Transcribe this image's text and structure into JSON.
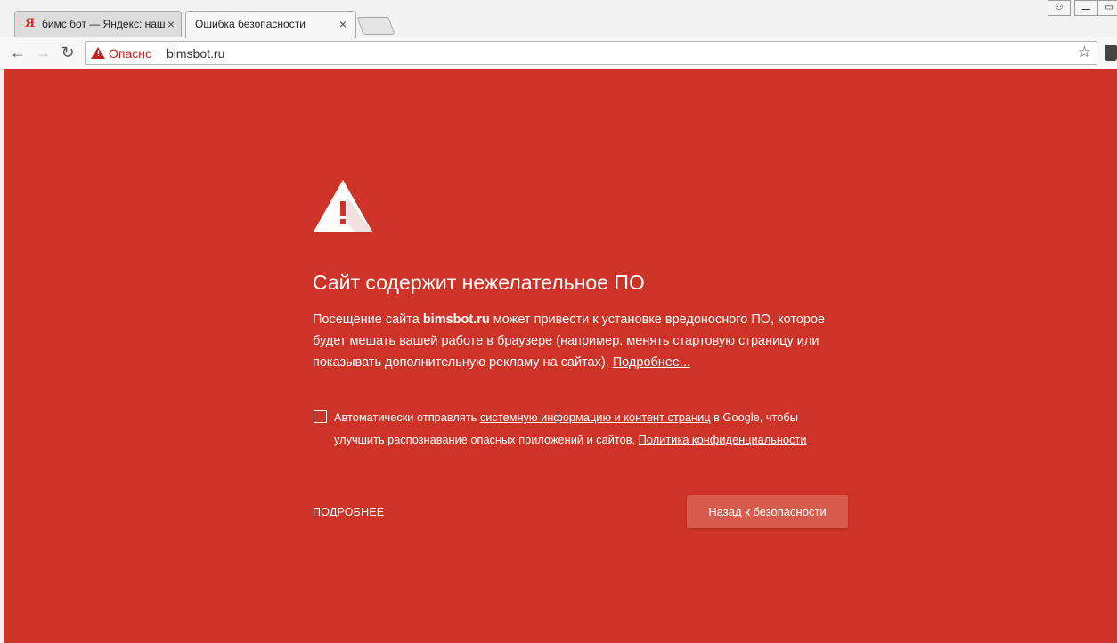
{
  "tabs": [
    {
      "title": "бимс бот — Яндекс: нашё",
      "favicon": "Я",
      "close": "×"
    },
    {
      "title": "Ошибка безопасности",
      "close": "×"
    }
  ],
  "window_controls": {
    "user": "⚇",
    "restore": "▭"
  },
  "toolbar": {
    "back": "←",
    "forward": "→",
    "reload": "↻",
    "security_label": "Опасно",
    "url": "bimsbot.ru",
    "star": "☆"
  },
  "interstitial": {
    "heading": "Сайт содержит нежелательное ПО",
    "body_prefix": "Посещение сайта ",
    "domain": "bimsbot.ru",
    "body_suffix": " может привести к установке вредоносного ПО, которое будет мешать вашей работе в браузере (например, менять стартовую страницу или показывать дополнительную рекламу на сайтах). ",
    "learn_more": "Подробнее...",
    "checkbox_prefix": "Автоматически отправлять ",
    "checkbox_link": "системную информацию и контент страниц",
    "checkbox_middle": " в Google, чтобы улучшить распознавание опасных приложений и сайтов. ",
    "privacy_link": "Политика конфиденциальности",
    "details_button": "ПОДРОБНЕЕ",
    "back_button": "Назад к безопасности"
  },
  "colors": {
    "page_background": "#cd3326",
    "primary_button": "#d85c4d",
    "danger": "#c5221f"
  }
}
